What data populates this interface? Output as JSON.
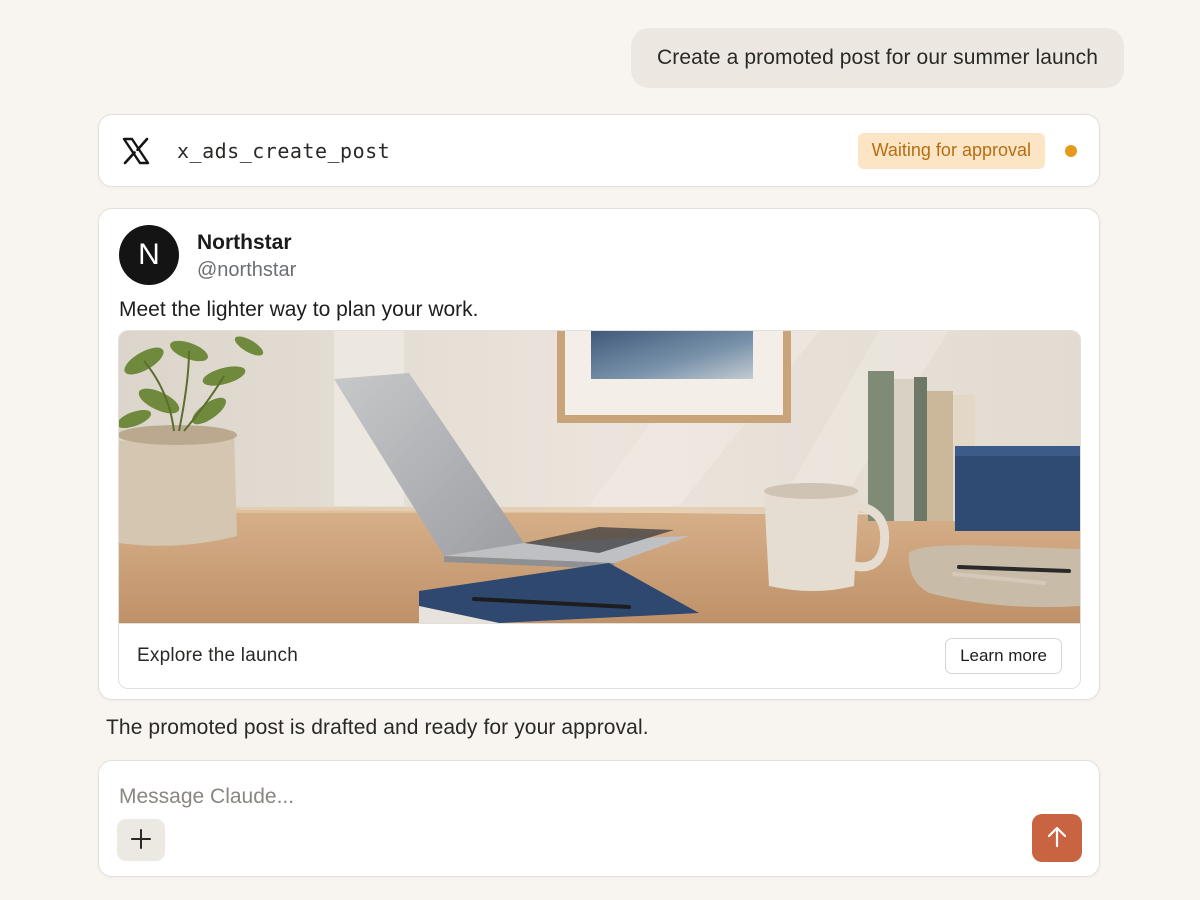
{
  "conversation": {
    "user_message": "Create a promoted post for our summer launch",
    "assistant_message": "The promoted post is drafted and ready for your approval."
  },
  "tool_call": {
    "icon": "x-logo-icon",
    "name": "x_ads_create_post",
    "status_label": "Waiting for approval",
    "status_color": "#e59a1c"
  },
  "post_preview": {
    "avatar_letter": "N",
    "account_name": "Northstar",
    "handle": "@northstar",
    "text": "Meet the lighter way to plan your work.",
    "media_description_icon": "desk-workspace-photo",
    "cta_headline": "Explore the launch",
    "cta_button": "Learn more"
  },
  "composer": {
    "placeholder": "Message Claude...",
    "add_icon": "plus-icon",
    "send_icon": "arrow-up-icon",
    "send_color": "#c96442"
  }
}
